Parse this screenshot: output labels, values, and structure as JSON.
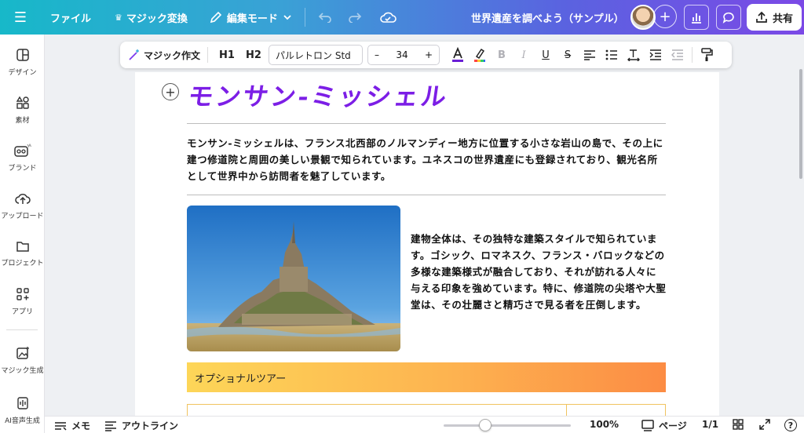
{
  "topbar": {
    "file_label": "ファイル",
    "magic_switch_label": "マジック変換",
    "edit_mode_label": "編集モード",
    "doc_title": "世界遺産を調べよう（サンプル）",
    "share_label": "共有"
  },
  "sidebar": {
    "items": [
      {
        "label": "デザイン"
      },
      {
        "label": "素材"
      },
      {
        "label": "ブランド"
      },
      {
        "label": "アップロード"
      },
      {
        "label": "プロジェクト"
      },
      {
        "label": "アプリ"
      },
      {
        "label": "マジック生成"
      },
      {
        "label": "AI音声生成"
      }
    ]
  },
  "format_toolbar": {
    "magic_write_label": "マジック作文",
    "h1_label": "H1",
    "h2_label": "H2",
    "font_name": "パルレトロン Std",
    "font_size": "34",
    "minus": "–",
    "plus": "+"
  },
  "page": {
    "title": "モンサン-ミッシェル",
    "paragraph1": "モンサン-ミッシェルは、フランス北西部のノルマンディー地方に位置する小さな岩山の島で、その上に建つ修道院と周囲の美しい景観で知られています。ユネスコの世界遺産にも登録されており、観光名所として世界中から訪問者を魅了しています。",
    "paragraph2": "建物全体は、その独特な建築スタイルで知られています。ゴシック、ロマネスク、フランス・バロックなどの多様な建築様式が融合しており、それが訪れる人々に与える印象を強めています。特に、修道院の尖塔や大聖堂は、その壮麗さと精巧さで見る者を圧倒します。",
    "banner_label": "オプショナルツアー"
  },
  "bottombar": {
    "memo_label": "メモ",
    "outline_label": "アウトライン",
    "zoom": "100%",
    "pages_label": "ページ",
    "page_count": "1/1",
    "help": "?"
  },
  "colors": {
    "title": "#7c1ee6",
    "banner_start": "#fdd658",
    "banner_end": "#fc8c44",
    "topbar_start": "#17b8c9",
    "topbar_end": "#7b49e6"
  }
}
